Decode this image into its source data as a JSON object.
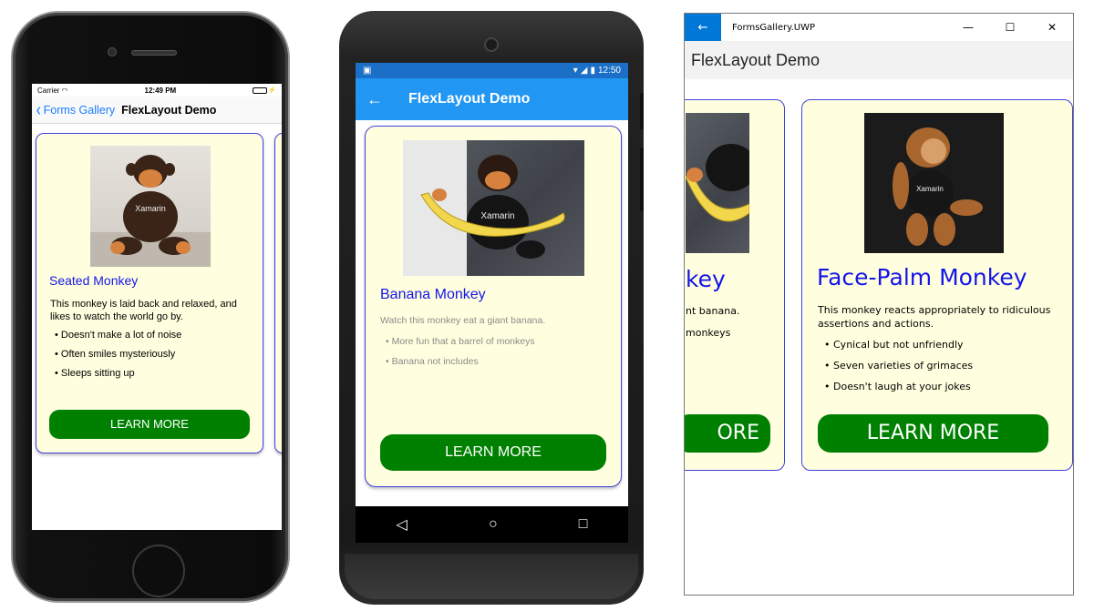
{
  "ios": {
    "status": {
      "carrier": "Carrier",
      "time": "12:49 PM"
    },
    "nav": {
      "back_label": "Forms Gallery",
      "title": "FlexLayout Demo"
    },
    "card": {
      "title": "Seated Monkey",
      "description": "This monkey is laid back and relaxed, and likes to watch the world go by.",
      "bullets": [
        "Doesn't make a lot of noise",
        "Often smiles mysteriously",
        "Sleeps sitting up"
      ],
      "button": "LEARN MORE",
      "photo_text": "Xamarin"
    }
  },
  "android": {
    "status": {
      "time": "12:50"
    },
    "appbar": {
      "title": "FlexLayout Demo",
      "back_icon": "arrow-left-icon"
    },
    "card": {
      "title": "Banana Monkey",
      "description": "Watch this monkey eat a giant banana.",
      "bullets": [
        "More fun that a barrel of monkeys",
        "Banana not includes"
      ],
      "button": "LEARN MORE",
      "photo_text": "Xamarin"
    },
    "navbar": {
      "back": "◁",
      "home": "○",
      "recents": "□"
    }
  },
  "uwp": {
    "window_title": "FormsGallery.UWP",
    "header": "FlexLayout Demo",
    "controls": {
      "minimize": "—",
      "maximize": "☐",
      "close": "✕"
    },
    "card_partial": {
      "title": "key",
      "description": "nt banana.",
      "bullet": "monkeys",
      "button": "ORE"
    },
    "card": {
      "title": "Face-Palm Monkey",
      "description": "This monkey reacts appropriately to ridiculous assertions and actions.",
      "bullets": [
        "Cynical but not unfriendly",
        "Seven varieties of grimaces",
        "Doesn't laugh at your jokes"
      ],
      "button": "LEARN MORE",
      "photo_text": "Xamarin"
    }
  },
  "colors": {
    "card_bg": "#ffffe0",
    "card_border": "#4040e0",
    "title_blue": "#1515e8",
    "button_green": "#008000",
    "android_appbar": "#2196f3",
    "ios_link": "#1a7cff",
    "uwp_accent": "#0078d7"
  }
}
